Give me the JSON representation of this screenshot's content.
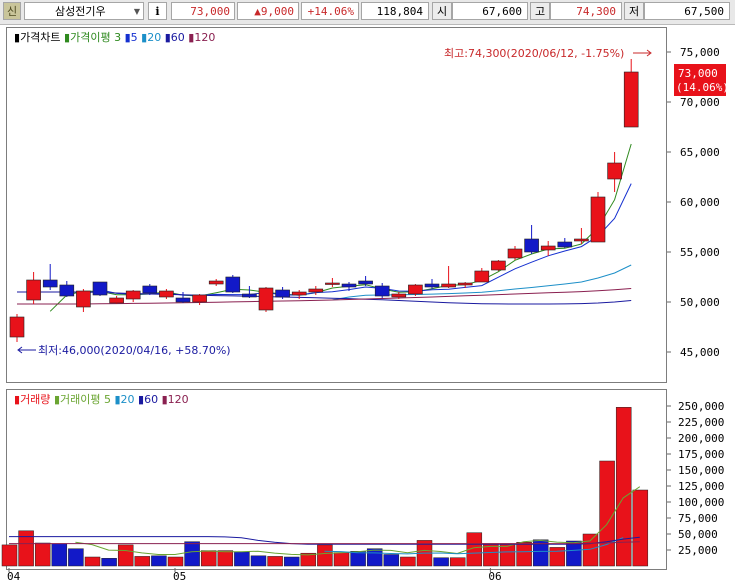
{
  "toolbar": {
    "market_badge": "신",
    "stock_name": "삼성전기우",
    "info_button": "i",
    "price": "73,000",
    "change": "▲9,000",
    "change_pct": "+14.06%",
    "volume": "118,804",
    "open_label": "시",
    "open_value": "67,600",
    "high_label": "고",
    "high_value": "74,300",
    "low_label": "저",
    "low_value": "67,500"
  },
  "price_legend": {
    "title": "가격차트",
    "ma_label": "가격이평",
    "ma_periods": [
      "3",
      "5",
      "20",
      "60",
      "120"
    ]
  },
  "volume_legend": {
    "title": "거래량",
    "ma_label": "거래이평",
    "ma_periods": [
      "5",
      "20",
      "60",
      "120"
    ]
  },
  "annotations": {
    "high": "최고:74,300(2020/06/12, -1.75%)",
    "low": "최저:46,000(2020/04/16, +58.70%)",
    "last_price": "73,000",
    "last_pct": "(14.06%)"
  },
  "colors": {
    "up": "#e8121a",
    "down": "#1219c8",
    "ma3": "#2f8a1f",
    "ma5": "#1530d0",
    "ma20": "#1c8fc8",
    "ma60": "#1a1aa0",
    "ma120": "#8a2050",
    "vol_ma5": "#6aa531"
  },
  "chart_data": [
    {
      "type": "candlestick",
      "ylim": [
        43000,
        76000
      ],
      "yticks": [
        "75,000",
        "70,000",
        "65,000",
        "60,000",
        "55,000",
        "50,000",
        "45,000"
      ],
      "xticks": [
        "04",
        "05",
        "06"
      ],
      "candles": [
        {
          "o": 46500,
          "h": 48800,
          "l": 46000,
          "c": 48500
        },
        {
          "o": 50200,
          "h": 53000,
          "l": 49800,
          "c": 52200
        },
        {
          "o": 52200,
          "h": 53800,
          "l": 51200,
          "c": 51500
        },
        {
          "o": 51700,
          "h": 52100,
          "l": 50500,
          "c": 50600
        },
        {
          "o": 49500,
          "h": 51300,
          "l": 49000,
          "c": 51100
        },
        {
          "o": 52000,
          "h": 52000,
          "l": 50600,
          "c": 50700
        },
        {
          "o": 49900,
          "h": 50600,
          "l": 49800,
          "c": 50400
        },
        {
          "o": 50300,
          "h": 51200,
          "l": 50000,
          "c": 51100
        },
        {
          "o": 51600,
          "h": 51800,
          "l": 50700,
          "c": 50900
        },
        {
          "o": 50500,
          "h": 51300,
          "l": 50300,
          "c": 51100
        },
        {
          "o": 50400,
          "h": 51000,
          "l": 49900,
          "c": 50000
        },
        {
          "o": 50000,
          "h": 50800,
          "l": 49700,
          "c": 50700
        },
        {
          "o": 51800,
          "h": 52300,
          "l": 51600,
          "c": 52100
        },
        {
          "o": 52500,
          "h": 52700,
          "l": 50900,
          "c": 51000
        },
        {
          "o": 50800,
          "h": 51600,
          "l": 50400,
          "c": 50500
        },
        {
          "o": 49200,
          "h": 51500,
          "l": 49000,
          "c": 51400
        },
        {
          "o": 51200,
          "h": 51500,
          "l": 50300,
          "c": 50500
        },
        {
          "o": 50700,
          "h": 51200,
          "l": 50300,
          "c": 51000
        },
        {
          "o": 51000,
          "h": 51600,
          "l": 50700,
          "c": 51300
        },
        {
          "o": 51800,
          "h": 52400,
          "l": 51500,
          "c": 51900
        },
        {
          "o": 51800,
          "h": 52000,
          "l": 51100,
          "c": 51500
        },
        {
          "o": 52100,
          "h": 52600,
          "l": 51600,
          "c": 51800
        },
        {
          "o": 51600,
          "h": 51900,
          "l": 50400,
          "c": 50600
        },
        {
          "o": 50500,
          "h": 51000,
          "l": 50300,
          "c": 50800
        },
        {
          "o": 50800,
          "h": 51800,
          "l": 50600,
          "c": 51700
        },
        {
          "o": 51800,
          "h": 52300,
          "l": 51300,
          "c": 51500
        },
        {
          "o": 51500,
          "h": 53600,
          "l": 51400,
          "c": 51800
        },
        {
          "o": 51700,
          "h": 52000,
          "l": 51400,
          "c": 51900
        },
        {
          "o": 52000,
          "h": 53400,
          "l": 52000,
          "c": 53100
        },
        {
          "o": 53200,
          "h": 54200,
          "l": 53100,
          "c": 54100
        },
        {
          "o": 54400,
          "h": 55600,
          "l": 54200,
          "c": 55300
        },
        {
          "o": 56300,
          "h": 57700,
          "l": 54800,
          "c": 55000
        },
        {
          "o": 55200,
          "h": 56100,
          "l": 54600,
          "c": 55600
        },
        {
          "o": 56000,
          "h": 56400,
          "l": 55400,
          "c": 55500
        },
        {
          "o": 56100,
          "h": 57400,
          "l": 55800,
          "c": 56300
        },
        {
          "o": 56000,
          "h": 61000,
          "l": 56000,
          "c": 60500
        },
        {
          "o": 62300,
          "h": 65000,
          "l": 61000,
          "c": 63900
        },
        {
          "o": 67500,
          "h": 74300,
          "l": 67500,
          "c": 73000
        }
      ],
      "series": [
        {
          "name": "3",
          "values": [
            null,
            null,
            49067,
            50700,
            51067,
            51067,
            50733,
            50733,
            50800,
            51033,
            50667,
            50600,
            50933,
            51267,
            51200,
            50967,
            50800,
            50667,
            50933,
            51400,
            51567,
            51733,
            51300,
            50967,
            51033,
            51333,
            51667,
            51733,
            52167,
            53033,
            54167,
            54800,
            55300,
            55367,
            55800,
            57433,
            60233,
            65800
          ]
        },
        {
          "name": "5",
          "values": [
            null,
            null,
            null,
            null,
            50780,
            51220,
            50860,
            50780,
            50840,
            50860,
            50700,
            50660,
            50760,
            50740,
            50740,
            50960,
            50700,
            50700,
            50940,
            51020,
            51240,
            51500,
            51360,
            51100,
            51080,
            51220,
            51280,
            51460,
            51640,
            52480,
            53320,
            53980,
            54620,
            55100,
            55540,
            56580,
            58360,
            61840
          ]
        },
        {
          "name": "20",
          "values": [
            null,
            null,
            null,
            null,
            null,
            null,
            null,
            null,
            null,
            null,
            null,
            null,
            null,
            null,
            null,
            null,
            null,
            null,
            null,
            50215,
            50500,
            50670,
            50700,
            50720,
            50750,
            50790,
            50840,
            50900,
            50970,
            51120,
            51300,
            51450,
            51620,
            51800,
            52000,
            52400,
            52900,
            53700
          ]
        },
        {
          "name": "60",
          "values": [
            51000,
            51000,
            51000,
            51000,
            51000,
            50960,
            50900,
            50850,
            50800,
            50760,
            50720,
            50680,
            50640,
            50610,
            50580,
            50540,
            50500,
            50460,
            50420,
            50380,
            50340,
            50280,
            50220,
            50150,
            50070,
            50000,
            49930,
            49870,
            49830,
            49810,
            49800,
            49800,
            49800,
            49810,
            49840,
            49900,
            50000,
            50150
          ]
        },
        {
          "name": "120",
          "values": [
            49800,
            49800,
            49800,
            49800,
            49800,
            49820,
            49840,
            49860,
            49880,
            49900,
            49920,
            49950,
            49980,
            50010,
            50040,
            50070,
            50100,
            50130,
            50160,
            50200,
            50250,
            50300,
            50350,
            50400,
            50450,
            50500,
            50560,
            50620,
            50680,
            50740,
            50800,
            50860,
            50920,
            50980,
            51040,
            51120,
            51220,
            51350
          ]
        }
      ]
    },
    {
      "type": "bar",
      "ylim": [
        0,
        260000
      ],
      "yticks": [
        "250,000",
        "225,000",
        "200,000",
        "175,000",
        "150,000",
        "125,000",
        "100,000",
        "75,000",
        "50,000",
        "25,000"
      ],
      "values": [
        33000,
        55000,
        36000,
        35000,
        27000,
        14000,
        12000,
        33000,
        15000,
        16000,
        14000,
        38000,
        24000,
        24000,
        22000,
        16000,
        15000,
        14000,
        20000,
        33000,
        21000,
        23000,
        27000,
        18000,
        14000,
        40000,
        13000,
        13000,
        52000,
        35000,
        35000,
        37000,
        41000,
        29000,
        39000,
        50000,
        164000,
        248000,
        118804
      ],
      "series": [
        {
          "name": "5",
          "values": [
            null,
            null,
            null,
            null,
            37200,
            33400,
            24800,
            24200,
            20400,
            18000,
            18000,
            22200,
            23400,
            22400,
            22400,
            23200,
            20200,
            18200,
            17400,
            19600,
            20600,
            22200,
            24800,
            24400,
            20800,
            24400,
            22600,
            19600,
            28400,
            30600,
            30600,
            37800,
            40000,
            37400,
            36200,
            39200,
            64600,
            106400,
            123961
          ]
        },
        {
          "name": "20",
          "values": [
            null,
            null,
            null,
            null,
            null,
            null,
            null,
            null,
            null,
            null,
            null,
            null,
            null,
            null,
            null,
            null,
            null,
            null,
            null,
            23050,
            22450,
            20850,
            20400,
            19550,
            18900,
            20200,
            20250,
            19250,
            20100,
            21100,
            22050,
            22150,
            22800,
            23200,
            24450,
            26150,
            33600,
            44300
          ]
        },
        {
          "name": "60",
          "values": [
            46000,
            46000,
            46000,
            46000,
            46000,
            46000,
            46000,
            46000,
            46000,
            46000,
            46000,
            46000,
            46000,
            45500,
            44000,
            40000,
            37000,
            35000,
            34000,
            34000,
            34000,
            34000,
            34000,
            34000,
            34000,
            34000,
            34000,
            34000,
            34000,
            34000,
            34000,
            34000,
            34000,
            34000,
            34000,
            35000,
            38000,
            42000,
            45000
          ]
        },
        {
          "name": "120",
          "values": [
            35000,
            35000,
            35000,
            35000,
            35000,
            35000,
            35000,
            35000,
            35000,
            35000,
            35000,
            35000,
            35000,
            35000,
            35000,
            35000,
            35000,
            35000,
            35000,
            35000,
            35000,
            35000,
            35000,
            35000,
            35000,
            35000,
            35000,
            35000,
            35000,
            35000,
            35000,
            35000,
            35000,
            35000,
            35000,
            35500,
            36000,
            37000,
            38000
          ]
        }
      ]
    }
  ]
}
